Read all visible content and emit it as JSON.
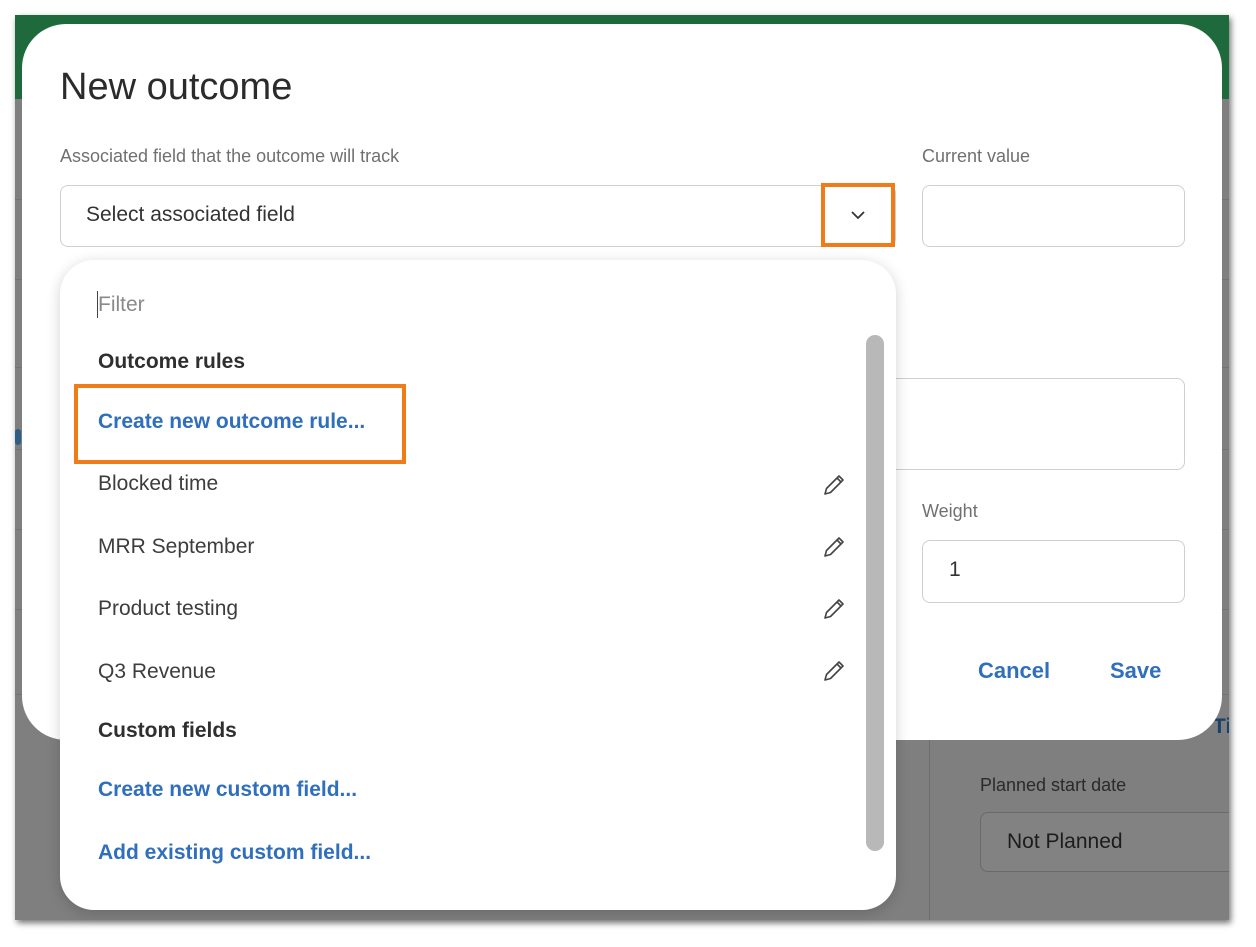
{
  "modal": {
    "title": "New outcome",
    "associated_field_label": "Associated field that the outcome will track",
    "associated_field_placeholder": "Select associated field",
    "current_value_label": "Current value",
    "current_value": "",
    "weight_label": "Weight",
    "weight_value": "1",
    "cancel_label": "Cancel",
    "save_label": "Save"
  },
  "dropdown": {
    "filter_placeholder": "Filter",
    "outcome_rules_heading": "Outcome rules",
    "create_outcome_rule": "Create new outcome rule...",
    "rules": [
      {
        "label": "Blocked time",
        "icon": "pencil-icon"
      },
      {
        "label": "MRR September",
        "icon": "pencil-icon"
      },
      {
        "label": "Product testing",
        "icon": "pencil-icon"
      },
      {
        "label": "Q3 Revenue",
        "icon": "pencil-icon"
      }
    ],
    "custom_fields_heading": "Custom fields",
    "create_custom_field": "Create new custom field...",
    "add_existing_custom_field": "Add existing custom field..."
  },
  "background": {
    "planned_start_label": "Planned start date",
    "planned_start_value": "Not Planned",
    "partial_link_text": "Tim"
  },
  "colors": {
    "highlight": "#f07c19",
    "link": "#2f6fbd",
    "header": "#1f6a3c"
  }
}
